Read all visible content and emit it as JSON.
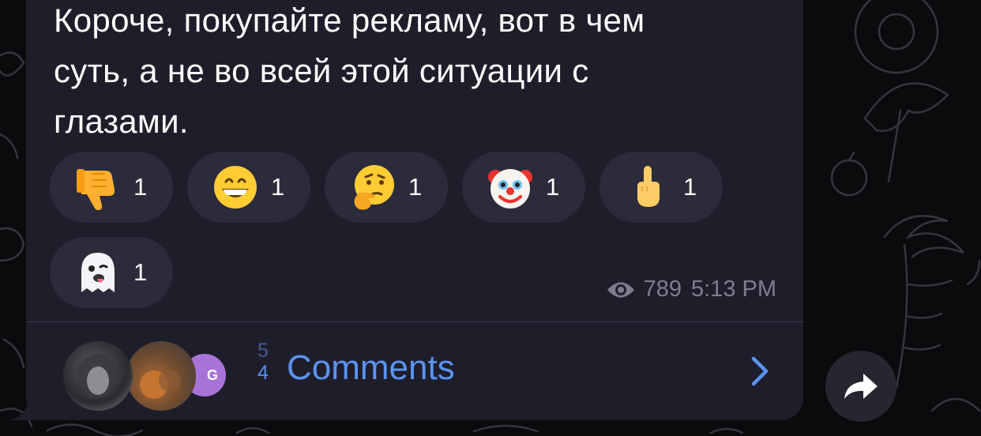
{
  "message": {
    "lines": [
      "Короче, покупайте рекламу, вот в чем",
      "суть, а не во всей этой ситуации с",
      "глазами."
    ]
  },
  "reactions": [
    {
      "emoji": "thumbs-down-icon",
      "count": "1"
    },
    {
      "emoji": "grinning-face-icon",
      "count": "1"
    },
    {
      "emoji": "thinking-face-icon",
      "count": "1"
    },
    {
      "emoji": "clown-face-icon",
      "count": "1"
    },
    {
      "emoji": "middle-finger-icon",
      "count": "1"
    },
    {
      "emoji": "ghost-icon",
      "count": "1"
    }
  ],
  "meta": {
    "views": "789",
    "time": "5:13 PM"
  },
  "comments": {
    "count_previous": "5",
    "count_current": "4",
    "label": "Comments",
    "avatar_initial": "G"
  },
  "colors": {
    "bubble": "#1e1e2b",
    "reaction_pill": "#2b2b3b",
    "accent": "#5b93f0",
    "meta_text": "#7d7d8d"
  }
}
